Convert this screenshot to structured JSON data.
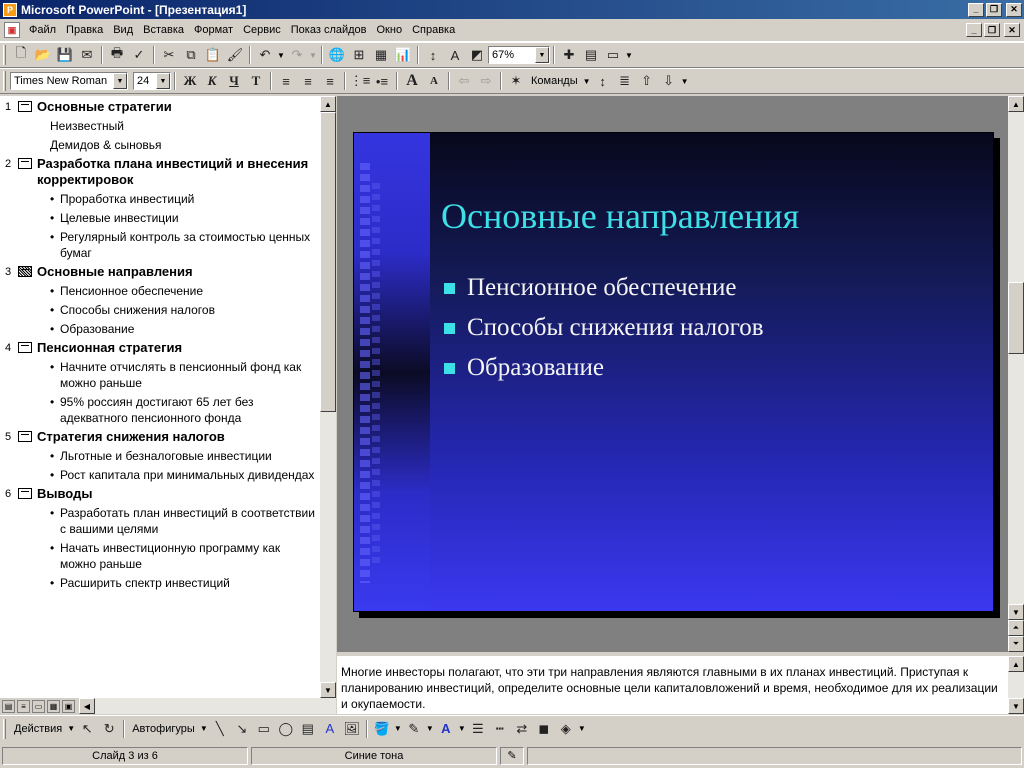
{
  "window": {
    "title": "Microsoft PowerPoint - [Презентация1]",
    "app_icon": "P"
  },
  "menu": [
    "Файл",
    "Правка",
    "Вид",
    "Вставка",
    "Формат",
    "Сервис",
    "Показ слайдов",
    "Окно",
    "Справка"
  ],
  "standard_toolbar": {
    "zoom": "67%"
  },
  "format_toolbar": {
    "font": "Times New Roman",
    "size": "24",
    "bold": "Ж",
    "italic": "К",
    "underline": "Ч",
    "shadow": "Т",
    "commands_label": "Команды"
  },
  "outline": {
    "slides": [
      {
        "num": "1",
        "title": "Основные стратегии",
        "subs": [
          "Неизвестный",
          "Демидов & сыновья"
        ],
        "bullets": []
      },
      {
        "num": "2",
        "title": "Разработка плана инвестиций и внесения корректировок",
        "subs": [],
        "bullets": [
          "Проработка инвестиций",
          "Целевые инвестиции",
          "Регулярный контроль за стоимостью ценных бумаг"
        ]
      },
      {
        "num": "3",
        "title": "Основные направления",
        "subs": [],
        "bullets": [
          "Пенсионное обеспечение",
          "Способы снижения налогов",
          "Образование"
        ]
      },
      {
        "num": "4",
        "title": "Пенсионная стратегия",
        "subs": [],
        "bullets": [
          "Начните отчислять в пенсионный фонд как можно раньше",
          "95% россиян достигают 65 лет без адекватного пенсионного фонда"
        ]
      },
      {
        "num": "5",
        "title": "Стратегия снижения налогов",
        "subs": [],
        "bullets": [
          "Льготные и безналоговые инвестиции",
          "Рост капитала при минимальных дивидендах"
        ]
      },
      {
        "num": "6",
        "title": "Выводы",
        "subs": [],
        "bullets": [
          "Разработать план инвестиций в соответствии с вашими целями",
          "Начать инвестиционную программу как можно раньше",
          "Расширить спектр инвестиций"
        ]
      }
    ]
  },
  "slide": {
    "title": "Основные направления",
    "bullets": [
      "Пенсионное обеспечение",
      "Способы снижения налогов",
      "Образование"
    ],
    "title_color": "#3ee0e8"
  },
  "notes": "Многие инвесторы полагают, что эти три направления являются главными в их планах инвестиций. Приступая к планированию инвестиций, определите основные цели капиталовложений и время, необходимое для их реализации и окупаемости.",
  "drawing_toolbar": {
    "actions_label": "Действия",
    "autoshapes_label": "Автофигуры"
  },
  "status": {
    "slide": "Слайд 3 из 6",
    "design": "Синие тона"
  }
}
